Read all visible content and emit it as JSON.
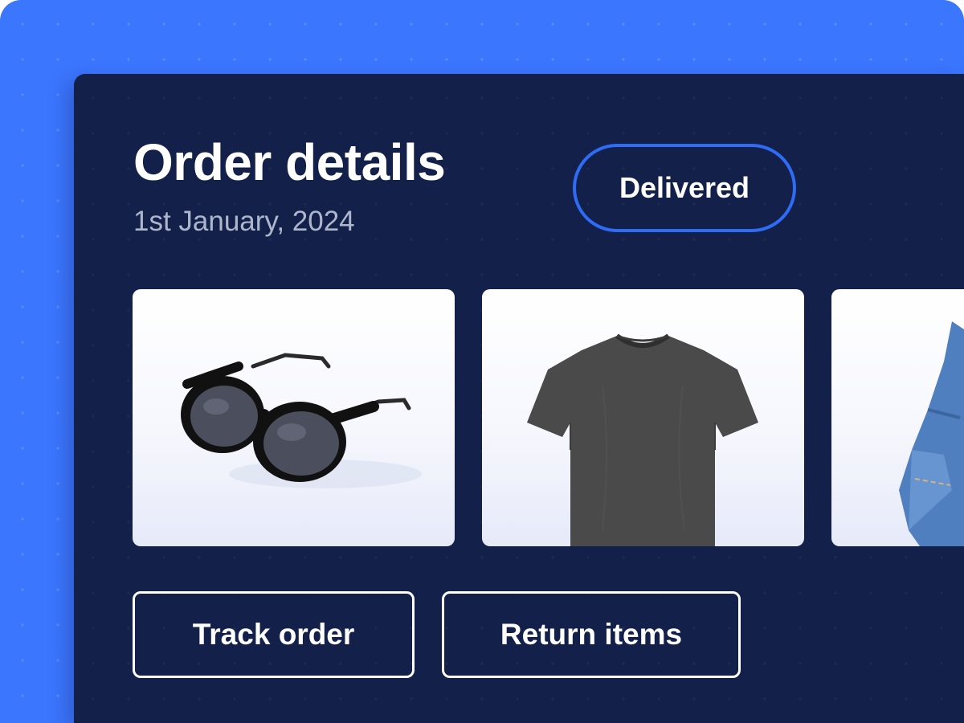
{
  "order": {
    "title": "Order details",
    "date": "1st January, 2024",
    "status": "Delivered"
  },
  "items": [
    {
      "name": "sunglasses",
      "icon": "sunglasses-image"
    },
    {
      "name": "t-shirt",
      "icon": "tshirt-image"
    },
    {
      "name": "jeans",
      "icon": "jeans-image"
    }
  ],
  "actions": {
    "track_label": "Track order",
    "return_label": "Return items"
  },
  "colors": {
    "background": "#3b76ff",
    "panel": "#13204a",
    "status_border": "#2e6cf6",
    "text": "#ffffff",
    "subtext": "#aeb6cc"
  }
}
